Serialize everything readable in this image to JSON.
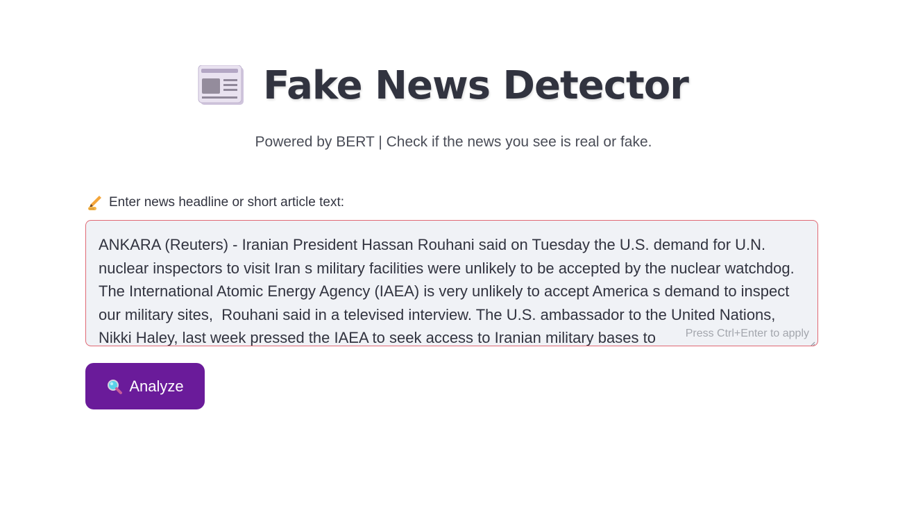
{
  "header": {
    "title": "Fake News Detector",
    "icon": "newspaper-icon",
    "subtitle": "Powered by BERT | Check if the news you see is real or fake."
  },
  "form": {
    "label": "Enter news headline or short article text:",
    "label_icon": "writing-hand-icon",
    "input_value": "ANKARA (Reuters) - Iranian President Hassan Rouhani said on Tuesday the U.S. demand for U.N. nuclear inspectors to visit Iran s military facilities were unlikely to be accepted by the nuclear watchdog.  The International Atomic Energy Agency (IAEA) is very unlikely to accept America s demand to inspect our military sites,  Rouhani said in a televised interview. The U.S. ambassador to the United Nations, Nikki Haley, last week pressed the IAEA to seek access to Iranian military bases to",
    "hint": "Press Ctrl+Enter to apply",
    "input_border_color": "#e06873",
    "input_background": "#f0f2f6"
  },
  "actions": {
    "analyze_label": "Analyze",
    "analyze_icon": "magnifying-glass-icon",
    "analyze_color": "#6a1b9a"
  }
}
